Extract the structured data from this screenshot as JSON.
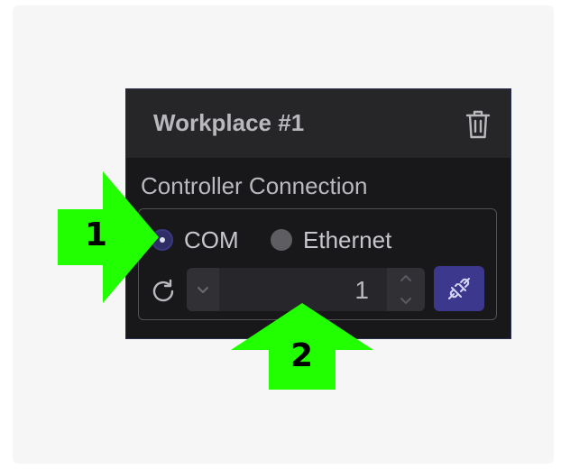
{
  "panel": {
    "title": "Workplace #1",
    "delete_icon": "trash-icon",
    "section_label": "Controller Connection"
  },
  "connection": {
    "options": [
      {
        "label": "COM",
        "checked": true
      },
      {
        "label": "Ethernet",
        "checked": false
      }
    ],
    "refresh_icon": "refresh-icon",
    "port_value": "1",
    "connect_icon": "plug-connect-icon"
  },
  "callouts": [
    {
      "number": "1",
      "direction": "right"
    },
    {
      "number": "2",
      "direction": "up"
    }
  ],
  "colors": {
    "accent": "#3b388e",
    "callout": "#22ff00",
    "panel_bg": "#18181b",
    "header_bg": "#262629"
  }
}
